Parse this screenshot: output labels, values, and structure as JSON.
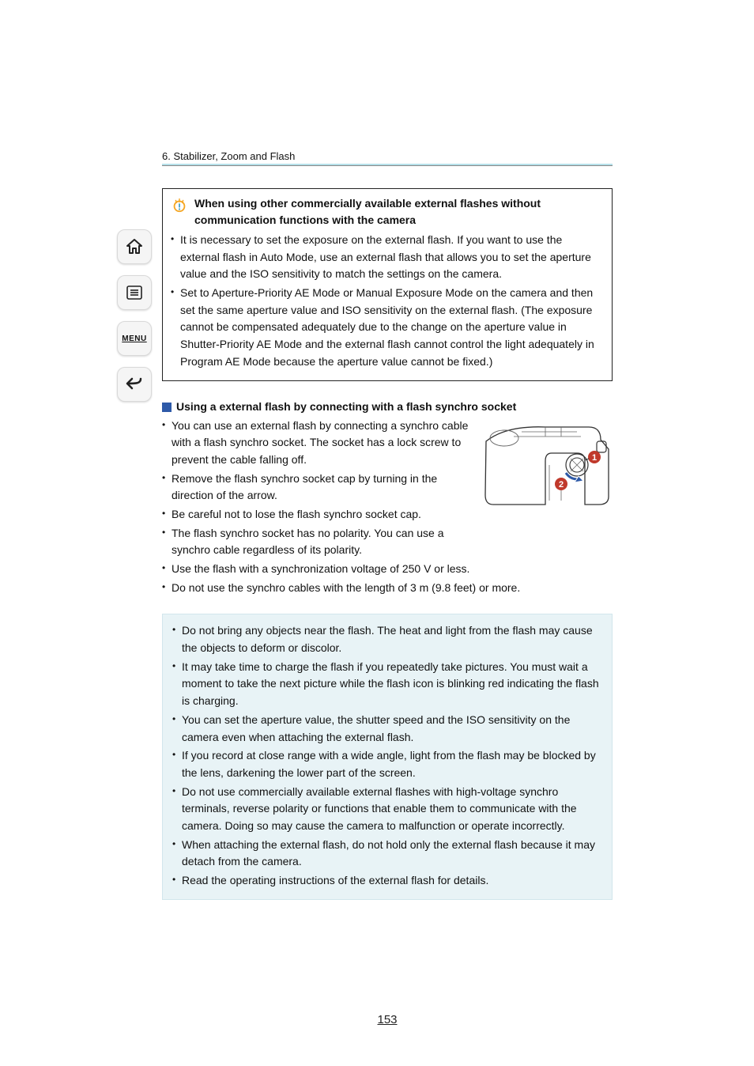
{
  "nav": {
    "home_label": "Home",
    "toc_label": "Contents",
    "menu_label": "MENU",
    "back_label": "Back"
  },
  "chapter": "6. Stabilizer, Zoom and Flash",
  "tip": {
    "title": "When using other commercially available external flashes without communication functions with the camera",
    "bullets": [
      "It is necessary to set the exposure on the external flash. If you want to use the external flash in Auto Mode, use an external flash that allows you to set the aperture value and the ISO sensitivity to match the settings on the camera.",
      "Set to Aperture-Priority AE Mode or Manual Exposure Mode on the camera and then set the same aperture value and ISO sensitivity on the external flash. (The exposure cannot be compensated adequately due to the change on the aperture value in Shutter-Priority AE Mode and the external flash cannot control the light adequately in Program AE Mode because the aperture value cannot be fixed.)"
    ]
  },
  "section": {
    "title": "Using a external flash by connecting with a flash synchro socket",
    "bullets": [
      "You can use an external flash by connecting a synchro cable with a flash synchro socket. The socket has a lock screw to prevent the cable falling off.",
      "Remove the flash synchro socket cap by turning in the direction of the arrow.",
      "Be careful not to lose the flash synchro socket cap.",
      "The flash synchro socket has no polarity. You can use a synchro cable regardless of its polarity.",
      "Use the flash with a synchronization voltage of 250 V or less.",
      "Do not use the synchro cables with the length of 3 m (9.8 feet) or more."
    ],
    "callouts": {
      "one": "1",
      "two": "2"
    }
  },
  "info": {
    "bullets": [
      "Do not bring any objects near the flash. The heat and light from the flash may cause the objects to deform or discolor.",
      "It may take time to charge the flash if you repeatedly take pictures. You must wait a moment to take the next picture while the flash icon is blinking red indicating the flash is charging.",
      "You can set the aperture value, the shutter speed and the ISO sensitivity on the camera even when attaching the external flash.",
      "If you record at close range with a wide angle, light from the flash may be blocked by the lens, darkening the lower part of the screen.",
      "Do not use commercially available external flashes with high-voltage synchro terminals, reverse polarity or functions that enable them to communicate with the camera. Doing so may cause the camera to malfunction or operate incorrectly.",
      "When attaching the external flash, do not hold only the external flash because it may detach from the camera.",
      "Read the operating instructions of the external flash for details."
    ]
  },
  "page_number": "153"
}
